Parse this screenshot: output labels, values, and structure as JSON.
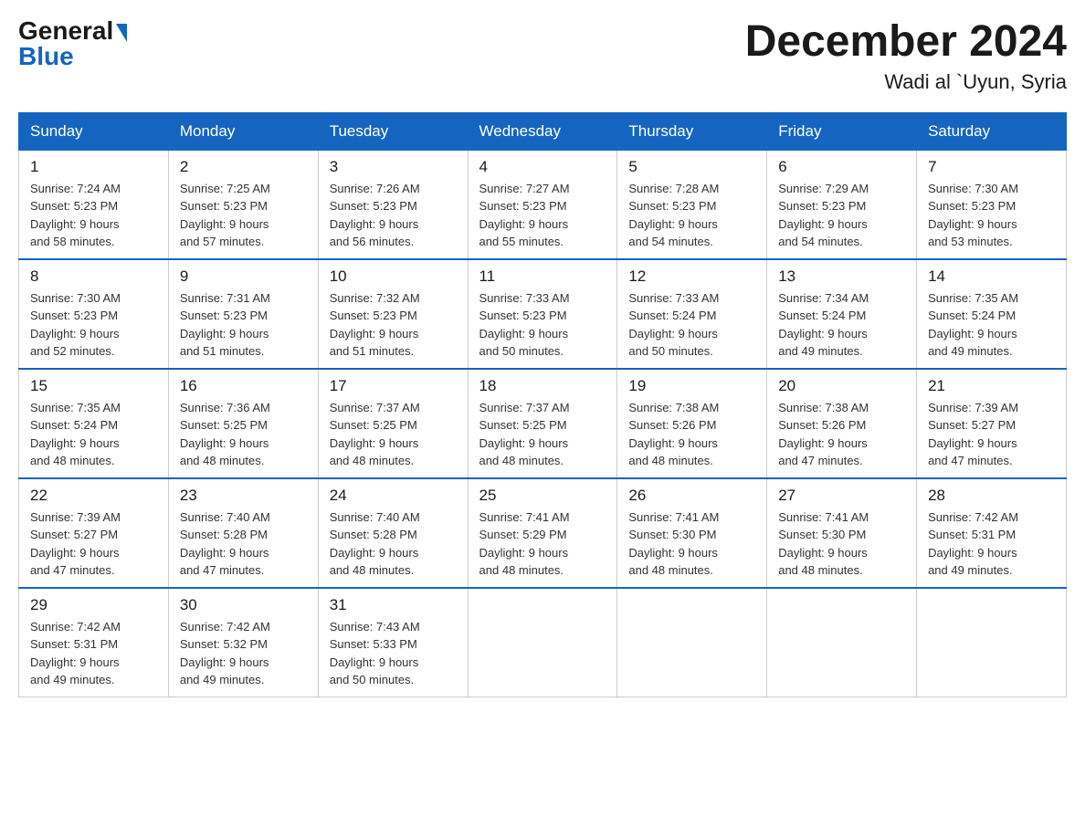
{
  "logo": {
    "general": "General",
    "blue": "Blue"
  },
  "title": {
    "month": "December 2024",
    "location": "Wadi al `Uyun, Syria"
  },
  "days_of_week": [
    "Sunday",
    "Monday",
    "Tuesday",
    "Wednesday",
    "Thursday",
    "Friday",
    "Saturday"
  ],
  "weeks": [
    [
      {
        "day": "1",
        "sunrise": "7:24 AM",
        "sunset": "5:23 PM",
        "daylight": "9 hours and 58 minutes."
      },
      {
        "day": "2",
        "sunrise": "7:25 AM",
        "sunset": "5:23 PM",
        "daylight": "9 hours and 57 minutes."
      },
      {
        "day": "3",
        "sunrise": "7:26 AM",
        "sunset": "5:23 PM",
        "daylight": "9 hours and 56 minutes."
      },
      {
        "day": "4",
        "sunrise": "7:27 AM",
        "sunset": "5:23 PM",
        "daylight": "9 hours and 55 minutes."
      },
      {
        "day": "5",
        "sunrise": "7:28 AM",
        "sunset": "5:23 PM",
        "daylight": "9 hours and 54 minutes."
      },
      {
        "day": "6",
        "sunrise": "7:29 AM",
        "sunset": "5:23 PM",
        "daylight": "9 hours and 54 minutes."
      },
      {
        "day": "7",
        "sunrise": "7:30 AM",
        "sunset": "5:23 PM",
        "daylight": "9 hours and 53 minutes."
      }
    ],
    [
      {
        "day": "8",
        "sunrise": "7:30 AM",
        "sunset": "5:23 PM",
        "daylight": "9 hours and 52 minutes."
      },
      {
        "day": "9",
        "sunrise": "7:31 AM",
        "sunset": "5:23 PM",
        "daylight": "9 hours and 51 minutes."
      },
      {
        "day": "10",
        "sunrise": "7:32 AM",
        "sunset": "5:23 PM",
        "daylight": "9 hours and 51 minutes."
      },
      {
        "day": "11",
        "sunrise": "7:33 AM",
        "sunset": "5:23 PM",
        "daylight": "9 hours and 50 minutes."
      },
      {
        "day": "12",
        "sunrise": "7:33 AM",
        "sunset": "5:24 PM",
        "daylight": "9 hours and 50 minutes."
      },
      {
        "day": "13",
        "sunrise": "7:34 AM",
        "sunset": "5:24 PM",
        "daylight": "9 hours and 49 minutes."
      },
      {
        "day": "14",
        "sunrise": "7:35 AM",
        "sunset": "5:24 PM",
        "daylight": "9 hours and 49 minutes."
      }
    ],
    [
      {
        "day": "15",
        "sunrise": "7:35 AM",
        "sunset": "5:24 PM",
        "daylight": "9 hours and 48 minutes."
      },
      {
        "day": "16",
        "sunrise": "7:36 AM",
        "sunset": "5:25 PM",
        "daylight": "9 hours and 48 minutes."
      },
      {
        "day": "17",
        "sunrise": "7:37 AM",
        "sunset": "5:25 PM",
        "daylight": "9 hours and 48 minutes."
      },
      {
        "day": "18",
        "sunrise": "7:37 AM",
        "sunset": "5:25 PM",
        "daylight": "9 hours and 48 minutes."
      },
      {
        "day": "19",
        "sunrise": "7:38 AM",
        "sunset": "5:26 PM",
        "daylight": "9 hours and 48 minutes."
      },
      {
        "day": "20",
        "sunrise": "7:38 AM",
        "sunset": "5:26 PM",
        "daylight": "9 hours and 47 minutes."
      },
      {
        "day": "21",
        "sunrise": "7:39 AM",
        "sunset": "5:27 PM",
        "daylight": "9 hours and 47 minutes."
      }
    ],
    [
      {
        "day": "22",
        "sunrise": "7:39 AM",
        "sunset": "5:27 PM",
        "daylight": "9 hours and 47 minutes."
      },
      {
        "day": "23",
        "sunrise": "7:40 AM",
        "sunset": "5:28 PM",
        "daylight": "9 hours and 47 minutes."
      },
      {
        "day": "24",
        "sunrise": "7:40 AM",
        "sunset": "5:28 PM",
        "daylight": "9 hours and 48 minutes."
      },
      {
        "day": "25",
        "sunrise": "7:41 AM",
        "sunset": "5:29 PM",
        "daylight": "9 hours and 48 minutes."
      },
      {
        "day": "26",
        "sunrise": "7:41 AM",
        "sunset": "5:30 PM",
        "daylight": "9 hours and 48 minutes."
      },
      {
        "day": "27",
        "sunrise": "7:41 AM",
        "sunset": "5:30 PM",
        "daylight": "9 hours and 48 minutes."
      },
      {
        "day": "28",
        "sunrise": "7:42 AM",
        "sunset": "5:31 PM",
        "daylight": "9 hours and 49 minutes."
      }
    ],
    [
      {
        "day": "29",
        "sunrise": "7:42 AM",
        "sunset": "5:31 PM",
        "daylight": "9 hours and 49 minutes."
      },
      {
        "day": "30",
        "sunrise": "7:42 AM",
        "sunset": "5:32 PM",
        "daylight": "9 hours and 49 minutes."
      },
      {
        "day": "31",
        "sunrise": "7:43 AM",
        "sunset": "5:33 PM",
        "daylight": "9 hours and 50 minutes."
      },
      null,
      null,
      null,
      null
    ]
  ],
  "labels": {
    "sunrise": "Sunrise:",
    "sunset": "Sunset:",
    "daylight": "Daylight:"
  }
}
